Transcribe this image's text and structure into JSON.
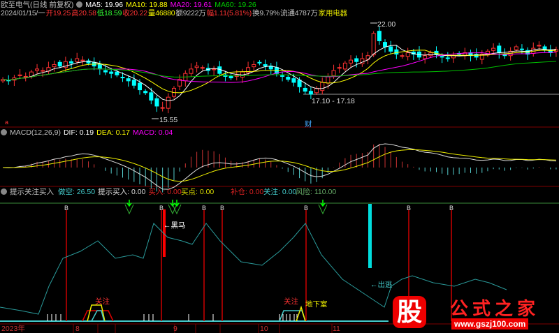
{
  "header": {
    "title": "欧至电气(日线 前复权)",
    "ma5": "MA5: 19.96",
    "ma10": "MA10: 19.88",
    "ma20": "MA20: 19.61",
    "ma60": "MA60: 19.26",
    "date": "2024/01/15/一",
    "open": "开19.25",
    "high": "高20.58",
    "low": "低18.59",
    "close": "收20.22",
    "volume": "量46880",
    "amount": "额9222万",
    "change": "幅1.11(5.81%)",
    "turnover": "换9.79%",
    "float": "流通4787万",
    "sector": "家用电器"
  },
  "price_panel": {
    "high_label": "22.00",
    "low_label": "15.55",
    "range_label": "17.10 - 17.18",
    "finance_marker": "财",
    "left_marker": "a"
  },
  "macd": {
    "title": "MACD(12,26,9)",
    "dif": "DIF: 0.19",
    "dea": "DEA: 0.17",
    "macd": "MACD: 0.04"
  },
  "indicator": {
    "title": "提示关注买入",
    "zuokong": "做空: 26.50",
    "tishi": "提示买入: 0.00",
    "mairu": "买入: 0.00",
    "maidian": "买点: 0.00",
    "bucang": "补仓: 0.00",
    "guanzhu": "关注: 0.00",
    "fengxian": "风险: 110.00",
    "heima": "←黑马",
    "chutao": "←出逃",
    "guanzhu_tag": "关注",
    "dixiashi": "地下室",
    "b": "B"
  },
  "xaxis": [
    "2023年",
    "8",
    "9",
    "10",
    "11"
  ],
  "watermark": {
    "text": "公式之家",
    "site": "www.gszj100.com",
    "logo": "股"
  },
  "colors": {
    "up": "#ff3232",
    "down": "#00ffff",
    "ma5": "#ffffff",
    "ma10": "#ffff00",
    "ma20": "#ff00ff",
    "ma60": "#00c000"
  },
  "chart_data": {
    "type": "candlestick",
    "closes": [
      18.2,
      18.1,
      18.3,
      18.5,
      18.4,
      18.7,
      18.9,
      18.8,
      19.0,
      19.2,
      19.1,
      19.4,
      19.3,
      19.6,
      19.5,
      19.3,
      19.1,
      18.9,
      18.7,
      18.6,
      18.5,
      18.3,
      18.1,
      17.8,
      17.5,
      17.3,
      16.8,
      16.4,
      16.3,
      17.0,
      17.6,
      18.2,
      18.6,
      18.9,
      19.1,
      19.0,
      18.8,
      18.9,
      18.6,
      18.4,
      18.3,
      18.5,
      18.7,
      19.0,
      19.2,
      19.3,
      19.1,
      18.9,
      18.6,
      18.4,
      18.2,
      18.0,
      17.7,
      17.4,
      17.2,
      17.6,
      18.0,
      18.4,
      18.8,
      19.0,
      19.3,
      19.5,
      19.4,
      19.6,
      19.8,
      21.3,
      20.8,
      20.4,
      20.1,
      19.9,
      19.8,
      20.0,
      19.9,
      19.7,
      19.8,
      20.0,
      19.9,
      19.7,
      19.6,
      19.8,
      19.9,
      20.0,
      19.8,
      19.7,
      19.9,
      20.1,
      20.3,
      20.0,
      19.8,
      20.1,
      20.4,
      20.2,
      19.9,
      20.3,
      20.5,
      20.2,
      20.0,
      20.2
    ]
  }
}
